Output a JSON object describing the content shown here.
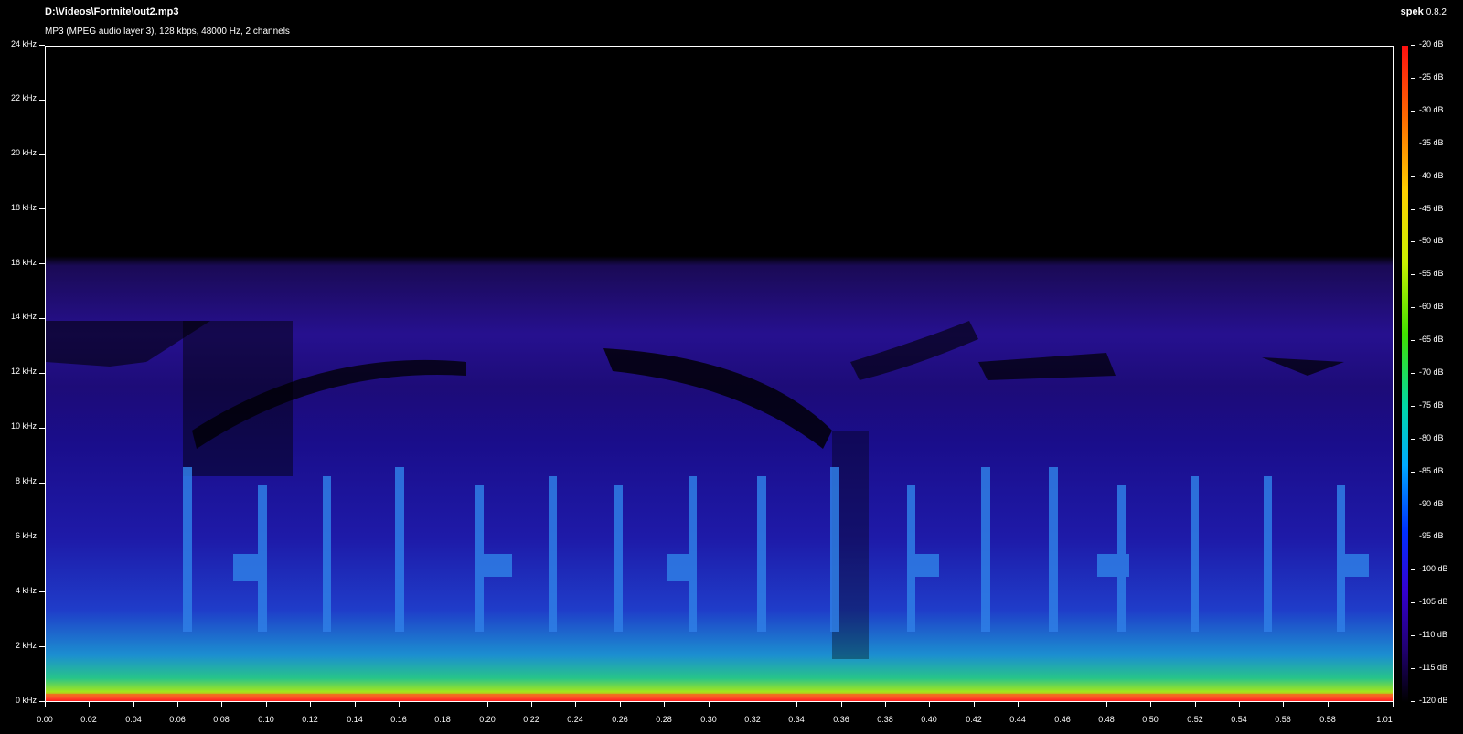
{
  "header": {
    "file_path": "D:\\Videos\\Fortnite\\out2.mp3",
    "stream_info": "MP3 (MPEG audio layer 3), 128 kbps, 48000 Hz, 2 channels",
    "app_name": "spek",
    "app_version": "0.8.2"
  },
  "frequency_axis": {
    "labels": [
      "24 kHz",
      "22 kHz",
      "20 kHz",
      "18 kHz",
      "16 kHz",
      "14 kHz",
      "12 kHz",
      "10 kHz",
      "8 kHz",
      "6 kHz",
      "4 kHz",
      "2 kHz",
      "0 kHz"
    ]
  },
  "time_axis": {
    "labels": [
      "0:00",
      "0:02",
      "0:04",
      "0:06",
      "0:08",
      "0:10",
      "0:12",
      "0:14",
      "0:16",
      "0:18",
      "0:20",
      "0:22",
      "0:24",
      "0:26",
      "0:28",
      "0:30",
      "0:32",
      "0:34",
      "0:36",
      "0:38",
      "0:40",
      "0:42",
      "0:44",
      "0:46",
      "0:48",
      "0:50",
      "0:52",
      "0:54",
      "0:56",
      "0:58",
      "1:01"
    ]
  },
  "level_scale": {
    "labels": [
      "-20 dB",
      "-25 dB",
      "-30 dB",
      "-35 dB",
      "-40 dB",
      "-45 dB",
      "-50 dB",
      "-55 dB",
      "-60 dB",
      "-65 dB",
      "-70 dB",
      "-75 dB",
      "-80 dB",
      "-85 dB",
      "-90 dB",
      "-95 dB",
      "-100 dB",
      "-105 dB",
      "-110 dB",
      "-115 dB",
      "-120 dB"
    ],
    "colors": [
      "#ff1010",
      "#ffcf00",
      "#40e000",
      "#00a8ff",
      "#0030ff",
      "#200070",
      "#000000"
    ]
  }
}
